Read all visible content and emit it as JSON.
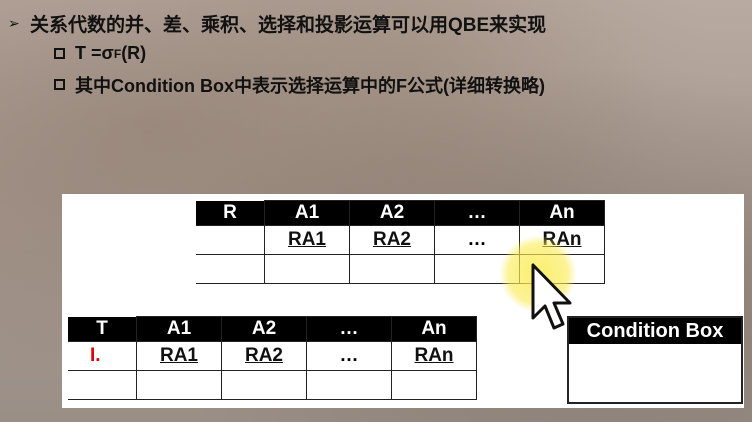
{
  "bullets": {
    "main": "关系代数的并、差、乘积、选择和投影运算可以用QBE来实现",
    "sub1": {
      "prefix": "T = ",
      "sigma": "σ",
      "subscript": "F",
      "suffix": "(R)"
    },
    "sub2": "其中Condition Box中表示选择运算中的F公式(详细转换略)"
  },
  "table_r": {
    "relation": "R",
    "headers": [
      "A1",
      "A2",
      "…",
      "An"
    ],
    "row1": [
      "RA1",
      "RA2",
      "…",
      "RAn"
    ]
  },
  "table_t": {
    "relation": "T",
    "row_label": "I.",
    "headers": [
      "A1",
      "A2",
      "…",
      "An"
    ],
    "row1": [
      "RA1",
      "RA2",
      "…",
      "RAn"
    ]
  },
  "condition_box": {
    "title": "Condition Box"
  }
}
